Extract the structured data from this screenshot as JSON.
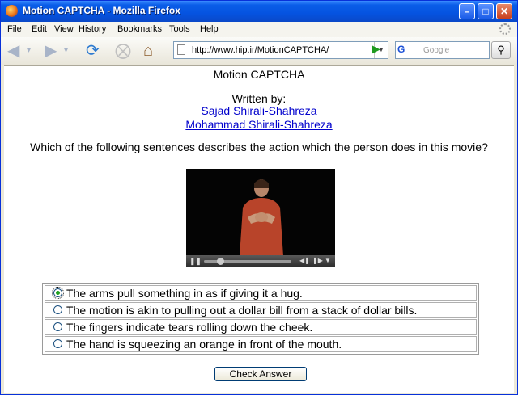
{
  "window": {
    "title": "Motion CAPTCHA - Mozilla Firefox"
  },
  "menu": {
    "items": [
      "File",
      "Edit",
      "View",
      "History",
      "Bookmarks",
      "Tools",
      "Help"
    ]
  },
  "navigation": {
    "url": "http://www.hip.ir/MotionCAPTCHA/",
    "search_placeholder": "Google",
    "search_engine_icon": "G"
  },
  "page": {
    "heading": "Motion CAPTCHA",
    "written_by": "Written by:",
    "authors": [
      "Sajad Shirali-Shahreza",
      "Mohammad Shirali-Shahreza"
    ],
    "question": "Which of the following sentences describes the action which the person does in this movie?",
    "options": [
      {
        "text": "The arms pull something in as if giving it a hug.",
        "selected": true
      },
      {
        "text": "The motion is akin to pulling out a dollar bill from a stack of dollar bills.",
        "selected": false
      },
      {
        "text": "The fingers indicate tears rolling down the cheek.",
        "selected": false
      },
      {
        "text": "The hand is squeezing an orange in front of the mouth.",
        "selected": false
      }
    ],
    "submit_label": "Check Answer"
  },
  "colors": {
    "titlebar": "#0553e0",
    "link": "#0000cc",
    "radio_selected": "#21a121",
    "shirt": "#b8442a"
  }
}
